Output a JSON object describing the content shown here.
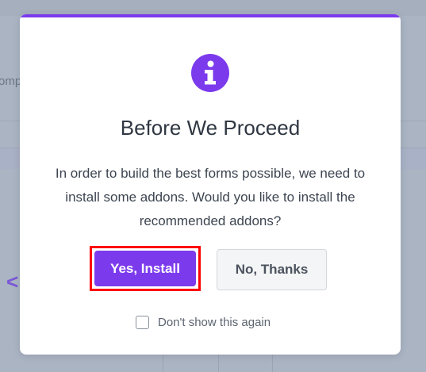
{
  "modal": {
    "title": "Before We Proceed",
    "message": "In order to build the best forms possible, we need to install some addons. Would you like to install the recommended addons?",
    "primary_button_label": "Yes, Install",
    "secondary_button_label": "No, Thanks",
    "checkbox_label": "Don't show this again",
    "checkbox_checked": false,
    "icon": "info-icon",
    "accent_color": "#7c3aed"
  },
  "background": {
    "fragment_text": "omp",
    "chevron_glyph": "<"
  }
}
